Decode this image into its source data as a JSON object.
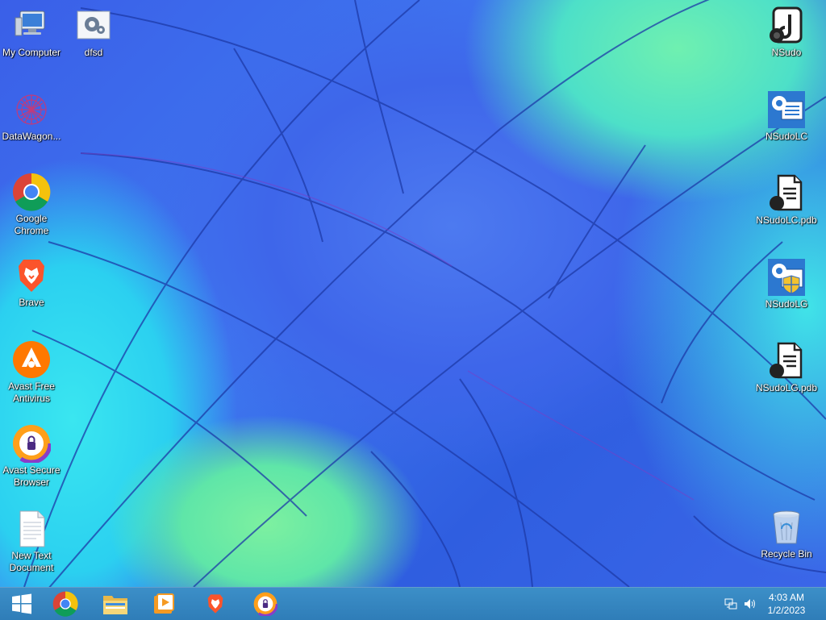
{
  "desktop": {
    "icons_left": [
      {
        "label": "My Computer",
        "icon": "computer-icon"
      },
      {
        "label": "DataWagon...",
        "icon": "datawagon-icon"
      },
      {
        "label": "Google Chrome",
        "icon": "chrome-icon"
      },
      {
        "label": "Brave",
        "icon": "brave-icon"
      },
      {
        "label": "Avast Free Antivirus",
        "icon": "avast-icon"
      },
      {
        "label": "Avast Secure Browser",
        "icon": "avast-browser-icon"
      },
      {
        "label": "New Text Document",
        "icon": "text-document-icon"
      }
    ],
    "icon_dfsd": {
      "label": "dfsd",
      "icon": "settings-shortcut-icon"
    },
    "icons_right": [
      {
        "label": "NSudo",
        "icon": "nsudo-icon"
      },
      {
        "label": "NSudoLC",
        "icon": "nsudolc-icon"
      },
      {
        "label": "NSudoLC.pdb",
        "icon": "pdb-file-icon"
      },
      {
        "label": "NSudoLG",
        "icon": "nsudolg-icon"
      },
      {
        "label": "NSudoLG.pdb",
        "icon": "pdb-file-icon"
      },
      {
        "label": "Recycle Bin",
        "icon": "recycle-bin-icon"
      }
    ]
  },
  "taskbar": {
    "pinned": [
      "start-button",
      "chrome-icon",
      "file-explorer-icon",
      "media-player-icon",
      "brave-icon",
      "avast-browser-icon"
    ],
    "tray": [
      "network-icon",
      "volume-icon"
    ],
    "clock": {
      "time": "4:03 AM",
      "date": "1/2/2023"
    }
  },
  "colors": {
    "taskbar": "#2f7db8",
    "wallpaper_blue": "#3a5fe8",
    "wallpaper_cyan": "#2bd0f0",
    "wallpaper_green": "#6ff0b0"
  }
}
